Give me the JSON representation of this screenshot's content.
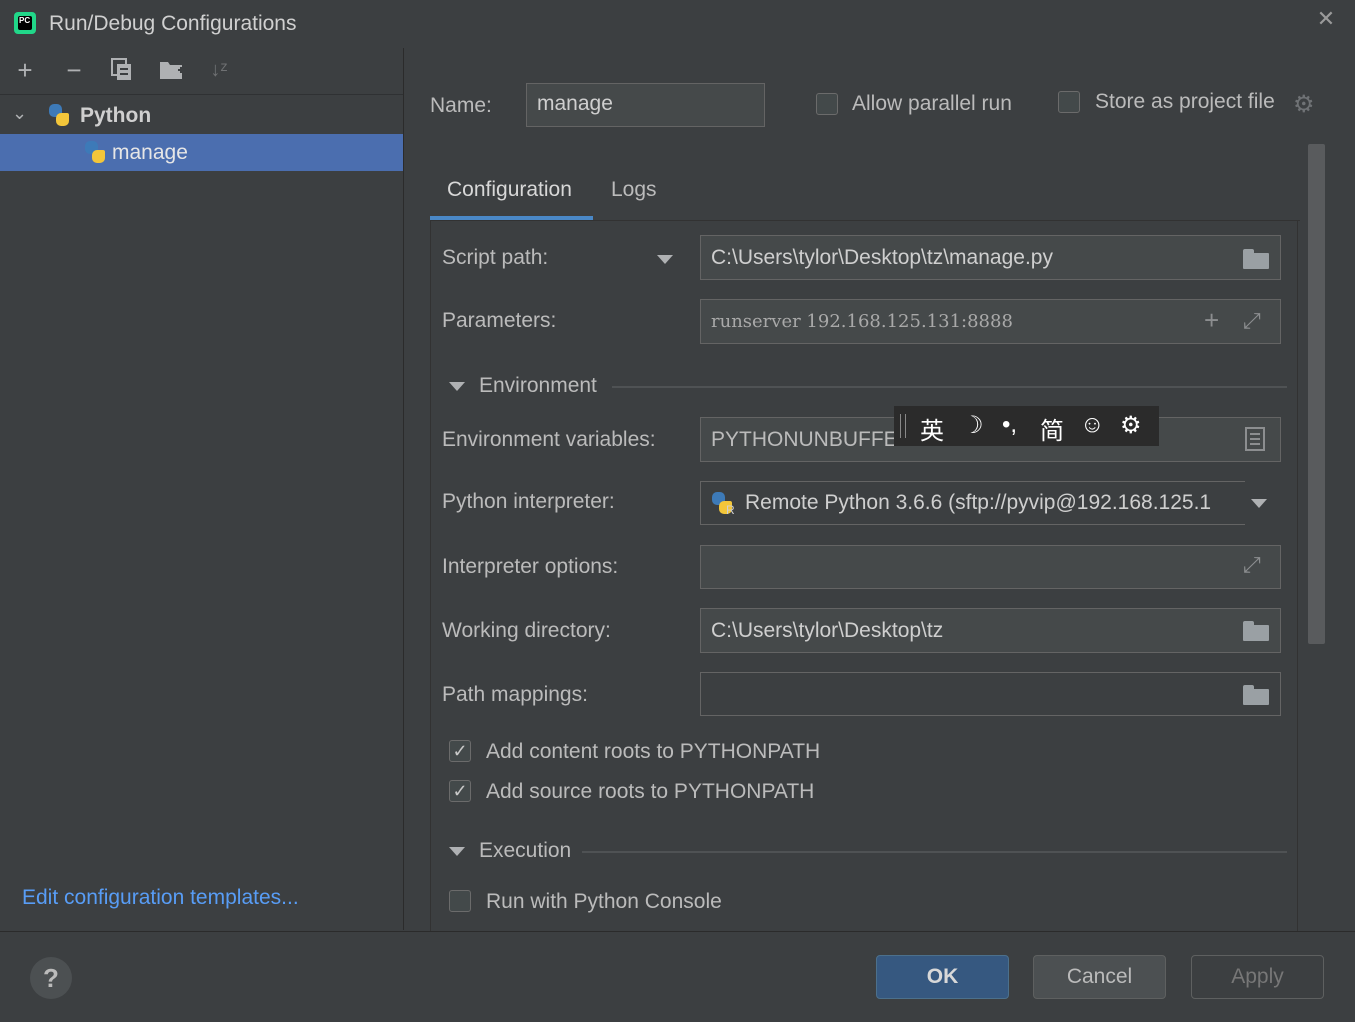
{
  "window": {
    "title": "Run/Debug Configurations",
    "close_icon": "close-icon"
  },
  "toolbar": {
    "icons": [
      "add-icon",
      "remove-icon",
      "copy-icon",
      "new-folder-icon",
      "sort-icon"
    ]
  },
  "tree": {
    "group_label": "Python",
    "items": [
      {
        "label": "manage",
        "selected": true
      }
    ]
  },
  "edit_templates_link": "Edit configuration templates...",
  "name_row": {
    "label": "Name:",
    "value": "manage",
    "allow_parallel_label": "Allow parallel run",
    "allow_parallel_checked": false,
    "store_project_label": "Store as project file",
    "store_project_checked": false
  },
  "tabs": [
    {
      "label": "Configuration",
      "active": true
    },
    {
      "label": "Logs",
      "active": false
    }
  ],
  "form": {
    "script_path_label": "Script path:",
    "script_path_value": "C:\\Users\\tylor\\Desktop\\tz\\manage.py",
    "parameters_label": "Parameters:",
    "parameters_value": "runserver 192.168.125.131:8888",
    "environment_section": "Environment",
    "env_vars_label": "Environment variables:",
    "env_vars_value": "PYTHONUNBUFFERED=1",
    "interpreter_label": "Python interpreter:",
    "interpreter_value": "Remote Python 3.6.6 (sftp://pyvip@192.168.125.1",
    "interp_options_label": "Interpreter options:",
    "interp_options_value": "",
    "working_dir_label": "Working directory:",
    "working_dir_value": "C:\\Users\\tylor\\Desktop\\tz",
    "path_mappings_label": "Path mappings:",
    "path_mappings_value": "",
    "content_roots_label": "Add content roots to PYTHONPATH",
    "content_roots_checked": true,
    "source_roots_label": "Add source roots to PYTHONPATH",
    "source_roots_checked": true,
    "execution_section": "Execution",
    "python_console_label": "Run with Python Console",
    "python_console_checked": false
  },
  "ime_toolbar": {
    "items": [
      "英",
      "☽",
      "•,",
      "简",
      "☺",
      "⚙"
    ]
  },
  "buttons": {
    "ok": "OK",
    "cancel": "Cancel",
    "apply": "Apply",
    "help": "?"
  },
  "colors": {
    "background": "#3c3f41",
    "selection": "#4b6eaf",
    "link": "#589df6",
    "accent": "#4a88c7"
  }
}
